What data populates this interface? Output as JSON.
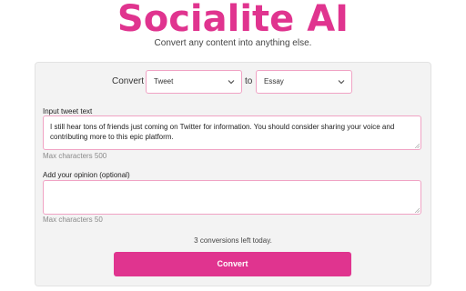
{
  "header": {
    "title": "Socialite AI",
    "subtitle": "Convert any content into anything else."
  },
  "converter": {
    "convert_label": "Convert",
    "from_value": "Tweet",
    "to_label": "to",
    "to_value": "Essay"
  },
  "input": {
    "label": "Input tweet text",
    "value": "I still hear tons of friends just coming on Twitter for information. You should consider sharing your voice and contributing more to this epic platform.",
    "helper": "Max characters 500"
  },
  "opinion": {
    "label": "Add your opinion (optional)",
    "value": "",
    "helper": "Max characters 50"
  },
  "status": {
    "conversions_left": "3 conversions left today."
  },
  "actions": {
    "convert_button": "Convert"
  },
  "colors": {
    "brand": "#e0348f",
    "field_border": "#f0a3c4",
    "card_background": "#f3f3f3"
  }
}
